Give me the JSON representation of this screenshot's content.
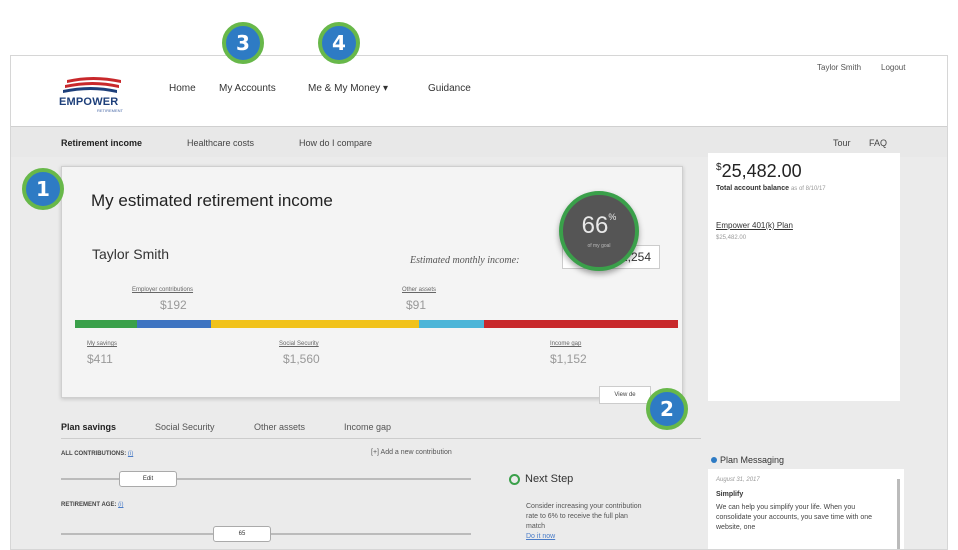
{
  "header": {
    "logo_text": "EMPOWER",
    "logo_sub": "RETIREMENT",
    "nav": [
      "Home",
      "My Accounts",
      "Me & My Money",
      "Guidance"
    ],
    "nav_caret": "▾",
    "user_name": "Taylor Smith",
    "logout": "Logout"
  },
  "subnav": {
    "tabs": [
      "Retirement income",
      "Healthcare costs",
      "How do I compare"
    ],
    "right": [
      "Tour",
      "FAQ"
    ]
  },
  "card": {
    "title": "My estimated retirement income",
    "name": "Taylor Smith",
    "est_label": "Estimated monthly income:",
    "est_value": "$2,254",
    "top_items": [
      {
        "label": "Employer contributions",
        "value": "$192"
      },
      {
        "label": "Other assets",
        "value": "$91"
      }
    ],
    "bottom_items": [
      {
        "label": "My savings",
        "value": "$411"
      },
      {
        "label": "Social Security",
        "value": "$1,560"
      },
      {
        "label": "Income gap",
        "value": "$1,152"
      }
    ],
    "bar_colors": [
      "#3aa04a",
      "#3e74c1",
      "#f1c21b",
      "#4cb5d8",
      "#c8282b"
    ],
    "gauge": {
      "value": "66",
      "unit": "%",
      "label": "of my goal"
    },
    "view_details": "View de"
  },
  "side": {
    "balance": "25,482.00",
    "currency": "$",
    "balance_label": "Total account balance",
    "balance_asof": "as of 8/10/17",
    "plan_name": "Empower 401(k) Plan",
    "plan_balance": "$25,482.00"
  },
  "tabs": [
    "Plan savings",
    "Social Security",
    "Other assets",
    "Income gap"
  ],
  "controls": {
    "all_contrib": "ALL CONTRIBUTIONS:",
    "edit": "Edit",
    "add_contrib": "[+] Add a new contribution",
    "ret_age": "RETIREMENT AGE:",
    "age": "65",
    "info": "(i)"
  },
  "next_step": {
    "title": "Next Step",
    "text": "Consider increasing your contribution rate to 6% to receive the full plan match",
    "link": "Do it now"
  },
  "plan_messaging": {
    "title": "Plan Messaging",
    "date": "August 31, 2017",
    "head": "Simplify",
    "body": "We can help you simplify your life. When you consolidate your accounts, you save time with one website, one"
  },
  "badges": [
    "1",
    "2",
    "3",
    "4"
  ]
}
